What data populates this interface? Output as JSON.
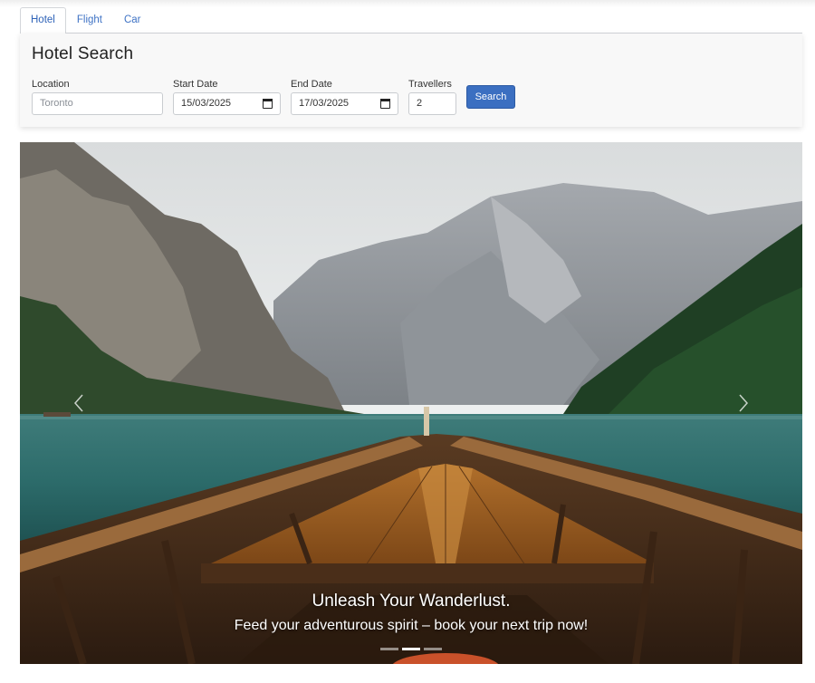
{
  "tabs": [
    {
      "label": "Hotel",
      "active": true
    },
    {
      "label": "Flight",
      "active": false
    },
    {
      "label": "Car",
      "active": false
    }
  ],
  "search": {
    "title": "Hotel Search",
    "location": {
      "label": "Location",
      "placeholder": "Toronto",
      "value": ""
    },
    "start_date": {
      "label": "Start Date",
      "value": "15/03/2025"
    },
    "end_date": {
      "label": "End Date",
      "value": "17/03/2025"
    },
    "travellers": {
      "label": "Travellers",
      "value": "2"
    },
    "button_label": "Search"
  },
  "carousel": {
    "image": "mountain-lake-boat-photo",
    "heading": "Unleash Your Wanderlust.",
    "subtext": "Feed your adventurous spirit – book your next trip now!",
    "slide_count": 3,
    "active_slide": 2,
    "prev_icon": "chevron-left-icon",
    "next_icon": "chevron-right-icon"
  },
  "colors": {
    "accent": "#3b6fc1",
    "tab_text": "#3f73c5"
  }
}
